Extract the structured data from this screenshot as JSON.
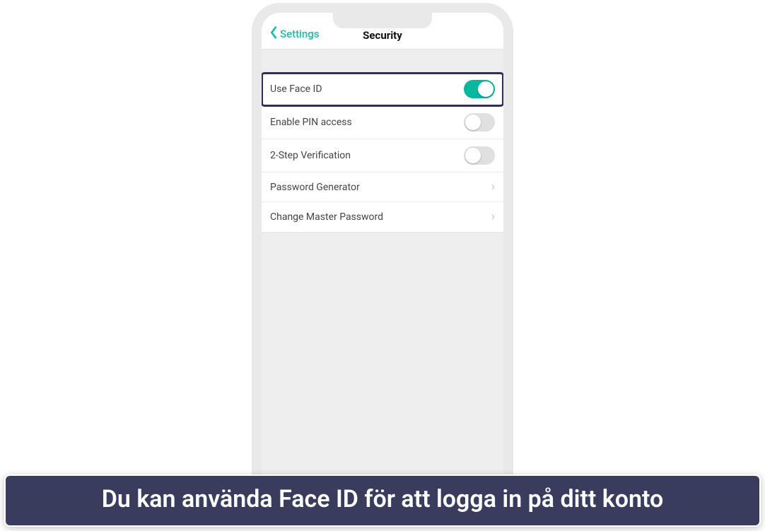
{
  "colors": {
    "accent": "#17bfa5",
    "highlight_border": "#312f57",
    "caption_bg": "#3a3c5e"
  },
  "nav": {
    "back_label": "Settings",
    "title": "Security"
  },
  "rows": {
    "face_id": {
      "label": "Use Face ID",
      "type": "toggle",
      "on": true,
      "highlight": true
    },
    "pin": {
      "label": "Enable PIN access",
      "type": "toggle",
      "on": false,
      "highlight": false
    },
    "twostep": {
      "label": "2-Step Verification",
      "type": "toggle",
      "on": false,
      "highlight": false
    },
    "pwgen": {
      "label": "Password Generator",
      "type": "link"
    },
    "master": {
      "label": "Change Master Password",
      "type": "link"
    }
  },
  "caption": "Du kan använda Face ID för att logga in på ditt konto"
}
